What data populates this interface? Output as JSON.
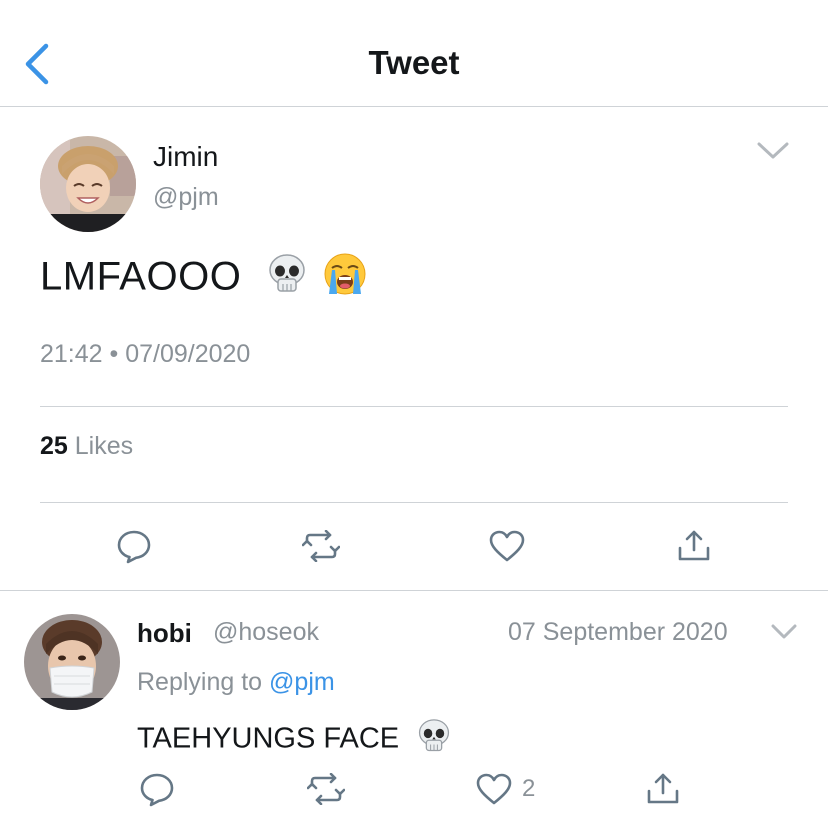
{
  "header": {
    "title": "Tweet",
    "back_icon": "chevron-left-icon"
  },
  "colors": {
    "accent": "#3b93e6",
    "text": "#14171a",
    "muted": "#8a9197",
    "divider": "#cfd3d7"
  },
  "tweet": {
    "name": "Jimin",
    "handle": "@pjm",
    "text": "LMFAOOO",
    "emojis": [
      "skull-icon",
      "loudly-crying-face-icon"
    ],
    "timestamp": "21:42 • 07/09/2020",
    "likes_count": "25",
    "likes_label": "Likes",
    "actions": [
      "reply-icon",
      "retweet-icon",
      "like-icon",
      "share-icon"
    ]
  },
  "reply": {
    "name": "hobi",
    "handle": "@hoseok",
    "date": "07 September 2020",
    "replying_prefix": "Replying to",
    "replying_to": "@pjm",
    "text": "TAEHYUNGS FACE",
    "emoji": "skull-icon",
    "like_count": "2",
    "actions": [
      "reply-icon",
      "retweet-icon",
      "like-icon",
      "share-icon"
    ]
  }
}
